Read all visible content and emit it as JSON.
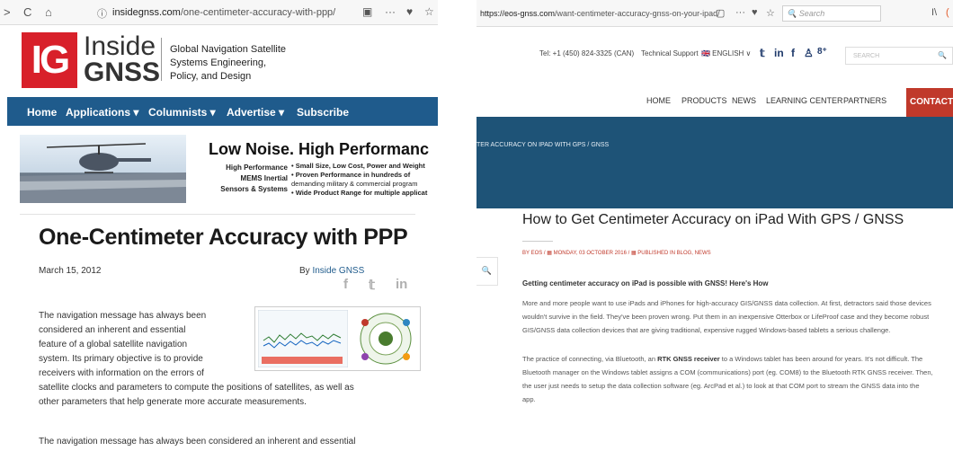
{
  "left": {
    "browser": {
      "back": ">",
      "reload": "C",
      "home": "⌂",
      "info": "ⓘ",
      "url_domain": "insidegnss.com",
      "url_path": "/one-centimeter-accuracy-with-ppp/",
      "reader": "▣",
      "more": "···",
      "pocket": "♥",
      "star": "☆"
    },
    "logo": {
      "mark": "IG",
      "word1": "Inside",
      "word2": "GNSS"
    },
    "tagline": [
      "Global Navigation Satellite",
      "Systems Engineering,",
      "Policy, and Design"
    ],
    "menu": [
      "Home",
      "Applications ▾",
      "Columnists ▾",
      "Advertise ▾",
      "Subscribe"
    ],
    "ad": {
      "title": "Low Noise. High Performanc",
      "left_lines": [
        "High Performance",
        "MEMS Inertial",
        "Sensors & Systems"
      ],
      "bullets": [
        "• Small Size, Low Cost, Power and Weight",
        "• Proven Performance in hundreds of",
        "   demanding military & commercial program",
        "• Wide Product Range for multiple applicat"
      ]
    },
    "article": {
      "title": "One-Centimeter Accuracy with PPP",
      "date": "March 15, 2012",
      "by": "By",
      "author": "Inside GNSS",
      "social": [
        "f",
        "𝕥",
        "in"
      ],
      "para1_lines": [
        "The navigation message has always been",
        "considered an inherent and essential",
        "feature of a global satellite navigation",
        "system. Its primary objective is to provide",
        "receivers with information on the errors of"
      ],
      "para1_cont": [
        "satellite clocks and parameters to compute the positions of satellites, as well as",
        "other parameters that help generate more accurate measurements."
      ],
      "para2": "The navigation message has always been considered an inherent and essential"
    }
  },
  "right": {
    "browser": {
      "url_domain": "https://eos-gnss.com",
      "url_path": "/want-centimeter-accuracy-gnss-on-your-ipad/",
      "reader": "▢",
      "more": "···",
      "pocket": "♥",
      "star": "☆",
      "search_placeholder": "🔍 Search",
      "library": "I\\",
      "account": "("
    },
    "topbar": {
      "tel": "Tel: +1 (450) 824-3325 (CAN)",
      "support": "Technical Support",
      "lang": "🇬🇧 ENGLISH ∨",
      "social": [
        "𝕥",
        "in",
        "f",
        "♙",
        "8⁺"
      ],
      "search": "SEARCH",
      "search_icon": "🔍"
    },
    "nav": [
      "HOME",
      "PRODUCTS",
      "NEWS",
      "LEARNING CENTER",
      "PARTNERS"
    ],
    "contact": "CONTACT",
    "breadcrumb": "TER ACCURACY ON IPAD WITH GPS / GNSS",
    "title": "How to Get Centimeter Accuracy on iPad With GPS / GNSS",
    "meta": "BY EOS  /  ▦  MONDAY, 03 OCTOBER 2016  /  ▦  PUBLISHED IN BLOG, NEWS",
    "side_search": "🔍",
    "heading": "Getting centimeter accuracy on iPad is possible with GNSS! Here's How",
    "para1": [
      "More and more people want to use iPads and iPhones for high-accuracy GIS/GNSS data collection. At first, detractors said those devices",
      "wouldn't survive in the field. They've been proven wrong. Put them in an inexpensive Otterbox or LifeProof case and they become robust",
      "GIS/GNSS data collection devices that are giving traditional, expensive rugged Windows-based tablets a serious challenge."
    ],
    "para2_a": "The practice of connecting, via Bluetooth, an ",
    "para2_b": "RTK GNSS receiver",
    "para2_c": " to a Windows tablet has been around for years. It's not difficult. The",
    "para2_rest": [
      "Bluetooth manager on the Windows tablet assigns a COM (communications) port (eg. COM8) to the Bluetooth RTK GNSS receiver. Then,",
      "the user just needs to setup the data collection software (eg. ArcPad et al.) to look at that COM port to stream the GNSS data into the",
      "app."
    ]
  }
}
